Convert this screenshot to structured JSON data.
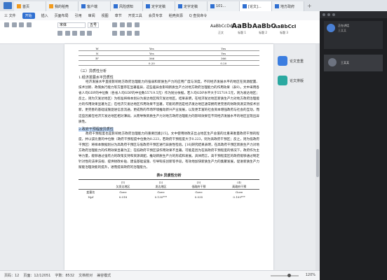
{
  "tabs": [
    {
      "label": "首页",
      "icon": "o"
    },
    {
      "label": "我的稻壳",
      "icon": "o"
    },
    {
      "label": "客户端",
      "icon": "w"
    },
    {
      "label": "风险感知",
      "icon": "w"
    },
    {
      "label": "定字定稿",
      "icon": "w"
    },
    {
      "label": "定字定稿",
      "icon": "w"
    },
    {
      "label": "101...",
      "icon": "w"
    },
    {
      "label": "[论文]...",
      "icon": "w"
    },
    {
      "label": "地方政府",
      "icon": "w"
    }
  ],
  "menu": [
    "三 文件",
    "开始",
    "插入",
    "页面布局",
    "引用",
    "审阅",
    "视图",
    "章节",
    "开发工具",
    "会员专享",
    "稻壳资源",
    "Q 查找命令"
  ],
  "ribbon": {
    "font_name": "宋体",
    "font_size": "五号",
    "styles": [
      {
        "sample": "AaBbCcDd",
        "label": "正文"
      },
      {
        "sample": "AaBb",
        "label": "标题 1"
      },
      {
        "sample": "AaBbC",
        "label": "标题 2"
      },
      {
        "sample": "AaBbCcI",
        "label": "标题 3"
      }
    ]
  },
  "video": {
    "user_name": "正在讲话",
    "user_sub": "王某某",
    "self_label": "王某某"
  },
  "side": {
    "btn1": "论文查重",
    "btn2": "论文排版"
  },
  "doc": {
    "top_table": [
      [
        "W",
        "Yes",
        "Yes"
      ],
      [
        "N",
        "Yes",
        "Yes"
      ],
      [
        "R²",
        "366",
        "366"
      ],
      [
        "",
        "0.20",
        "0.20"
      ]
    ],
    "section": "（三）异质性分析",
    "sub1": "1.经济发展水平异质性",
    "para1": "经济发展水平直接影响地方政府治理能力的强弱和新质生产力的应用广度与深度。不同经济发展水平的地区在资源配置、技术创新、政策执行能力等方面存在显著差异，这些差异会影响新质生产力对地方政府治理能力的作用效果（表9）。文中采用各省人均GDP的中位数（各省人均GDP的中位数55719.5元）作为划分依据，若人均GDP水平大于55719.5元，则为发达地区；反之，则为欠发达地区）为标准将样本划分为发达地区和欠发达地区。结果表明，在经济发达地区新质生产力对地方政府治理能力的作用效果显著为正；在经济欠发达地区作用效果不显著。可能的原因是经济发达地区通常拥有更完善的财政资源支持技术创新，更完善的基础设施促进信息流通，更成熟的市场环境推动新兴产业发展，以及更丰富的社会资本增强政府与社会的互动，而这些因素在经济欠发达地区相对薄弱，从而导致新质生产力对地方政府治理能力的影响效果在不同经济发展水平的地区呈现出异质性。",
    "sub2": "2.政府干预程度异质性",
    "para2": "政府干预程度也是影响地方政府治理能力的重要因素[15]，文中使用财政支出占地区生产总值的比重来衡量政府干预的程度，并以该比重的中位数（政府干预程度中位数为0.223，若政府干预程度大于0.223，则为高政府干预区；反之，则为低政府干预区）将样本数据划分为高政府干预区与低政府干预区进行异质性检验。[16]研究结果表明，在高政府干预区新质生产力对地方政府治理能力的作用效果显著为正；在低政府干预区该作用效果不显著。可能是因为在高政府干预程度的情况下，政府作为主导力量，能够通过强有力的政策支持和资源调配，推动新质生产力的形成和发展。具体而言，高干预程度区的政府能够通过制定针对性的法律法规、提供财政补贴、建设基础设施、引导科技创新等手段，有效地加快新质生产力的集聚发展，促进新质生产力赋能治理效能的提升，进而提高政府的治理能力。",
    "caption": "表9  异质性分析",
    "bottom_head": [
      "",
      "(1)",
      "(2)",
      "(3)",
      "(4)"
    ],
    "bottom_head2": [
      "",
      "欠发达地区",
      "发达地区",
      "低政府干预",
      "高政府干预"
    ],
    "bottom_rows": [
      [
        "变量名",
        "Gove",
        "Gove",
        "Gove",
        "Gove"
      ],
      [
        "Npf",
        "0.018",
        "0.130***",
        "0.035",
        "0.109***"
      ]
    ]
  },
  "status": {
    "page": "页码：12",
    "pages": "页面：12/12051",
    "words": "字数：8532",
    "check": "文档校对",
    "mode": "兼容模式",
    "zoom": "120%"
  }
}
